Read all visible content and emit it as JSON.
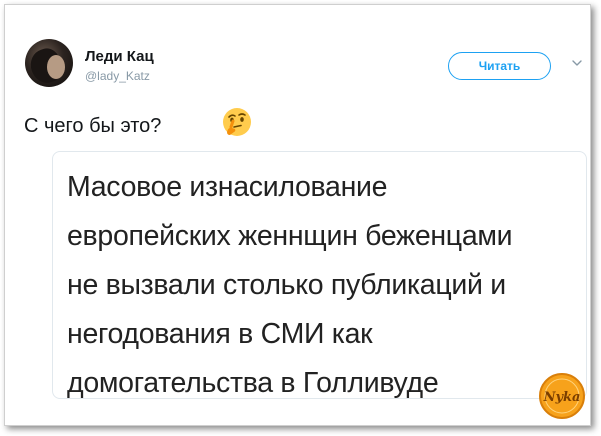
{
  "tweet": {
    "author_name": "Леди Кац",
    "author_handle": "@lady_Katz",
    "follow_label": "Читать",
    "text": "С чего бы это?",
    "emoji": "thinking-face"
  },
  "card": {
    "lines": [
      "Масовое изнасилование",
      "европейских женнщин беженцами",
      "не вызвали столько публикаций и",
      "негодования в СМИ как",
      "домогательства в Голливуде"
    ]
  },
  "watermark": {
    "text": "Nyka"
  },
  "colors": {
    "accent": "#1da1f2",
    "text": "#14171a",
    "muted": "#8899a6",
    "card_border": "#e1e8ed"
  }
}
